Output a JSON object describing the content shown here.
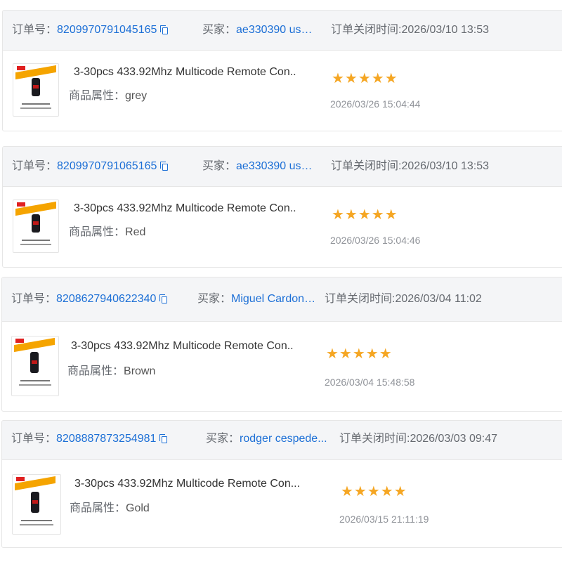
{
  "labels": {
    "order_no": "订单号：",
    "buyer": "买家：",
    "close_time": "订单关闭时间:",
    "attr": "商品属性："
  },
  "icons": {
    "copy": "copy-icon",
    "star": "star-icon",
    "product_thumbnail": "remote-control-thumbnail"
  },
  "colors": {
    "link": "#1c6fd6",
    "star": "#f5a623",
    "header_bg": "#f4f5f7"
  },
  "orders": [
    {
      "order_number": "8209970791045165",
      "buyer": "ae330390 user...",
      "close_time": "2026/03/10 13:53",
      "product_title": "3-30pcs 433.92Mhz Multicode Remote Con..",
      "attr_value": "grey",
      "rating": 5,
      "stars": "★★★★★",
      "review_time": "2026/03/26 15:04:44"
    },
    {
      "order_number": "8209970791065165",
      "buyer": "ae330390 user...",
      "close_time": "2026/03/10 13:53",
      "product_title": "3-30pcs 433.92Mhz Multicode Remote Con..",
      "attr_value": "Red",
      "rating": 5,
      "stars": "★★★★★",
      "review_time": "2026/03/26 15:04:46"
    },
    {
      "order_number": "8208627940622340",
      "buyer": "Miguel Cardona...",
      "close_time": "2026/03/04 11:02",
      "product_title": "3-30pcs 433.92Mhz Multicode Remote Con..",
      "attr_value": "Brown",
      "rating": 5,
      "stars": "★★★★★",
      "review_time": "2026/03/04 15:48:58"
    },
    {
      "order_number": "8208887873254981",
      "buyer": "rodger cespede...",
      "close_time": "2026/03/03 09:47",
      "product_title": "3-30pcs 433.92Mhz Multicode Remote Con...",
      "attr_value": "Gold",
      "rating": 5,
      "stars": "★★★★★",
      "review_time": "2026/03/15 21:11:19"
    }
  ]
}
